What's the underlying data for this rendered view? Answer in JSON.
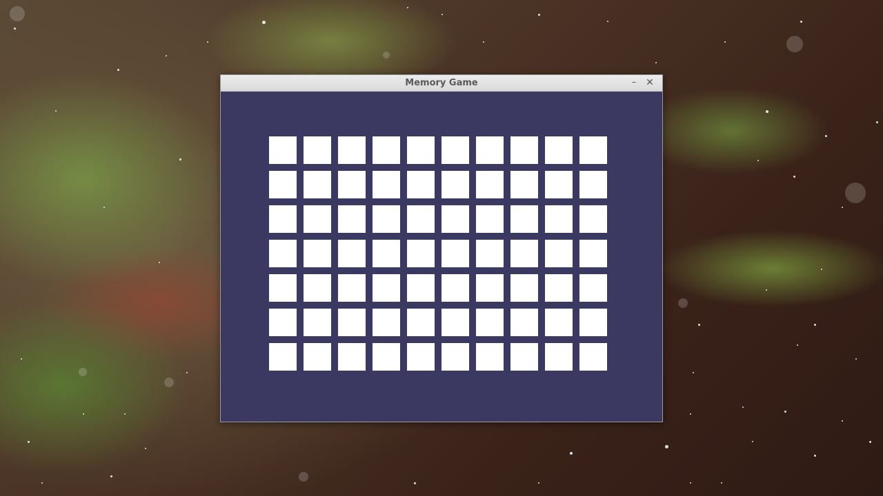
{
  "window": {
    "title": "Memory Game",
    "minimize_label": "–",
    "close_label": "✕"
  },
  "board": {
    "rows": 7,
    "columns": 10,
    "card_color": "#ffffff",
    "background_color": "#3b3961"
  }
}
